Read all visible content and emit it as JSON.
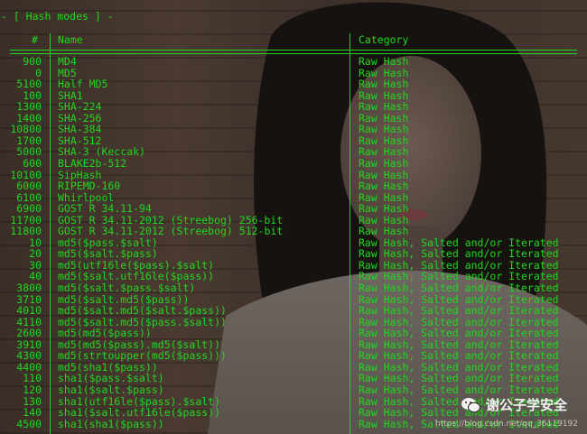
{
  "title": "- [ Hash modes ] -",
  "headers": {
    "num": "#",
    "name": "Name",
    "category": "Category"
  },
  "rows": [
    {
      "num": "900",
      "name": "MD4",
      "cat": "Raw Hash"
    },
    {
      "num": "0",
      "name": "MD5",
      "cat": "Raw Hash"
    },
    {
      "num": "5100",
      "name": "Half MD5",
      "cat": "Raw Hash"
    },
    {
      "num": "100",
      "name": "SHA1",
      "cat": "Raw Hash"
    },
    {
      "num": "1300",
      "name": "SHA-224",
      "cat": "Raw Hash"
    },
    {
      "num": "1400",
      "name": "SHA-256",
      "cat": "Raw Hash"
    },
    {
      "num": "10800",
      "name": "SHA-384",
      "cat": "Raw Hash"
    },
    {
      "num": "1700",
      "name": "SHA-512",
      "cat": "Raw Hash"
    },
    {
      "num": "5000",
      "name": "SHA-3 (Keccak)",
      "cat": "Raw Hash"
    },
    {
      "num": "600",
      "name": "BLAKE2b-512",
      "cat": "Raw Hash"
    },
    {
      "num": "10100",
      "name": "SipHash",
      "cat": "Raw Hash"
    },
    {
      "num": "6000",
      "name": "RIPEMD-160",
      "cat": "Raw Hash"
    },
    {
      "num": "6100",
      "name": "Whirlpool",
      "cat": "Raw Hash"
    },
    {
      "num": "6900",
      "name": "GOST R 34.11-94",
      "cat": "Raw Hash"
    },
    {
      "num": "11700",
      "name": "GOST R 34.11-2012 (Streebog) 256-bit",
      "cat": "Raw Hash"
    },
    {
      "num": "11800",
      "name": "GOST R 34.11-2012 (Streebog) 512-bit",
      "cat": "Raw Hash"
    },
    {
      "num": "10",
      "name": "md5($pass.$salt)",
      "cat": "Raw Hash, Salted and/or Iterated"
    },
    {
      "num": "20",
      "name": "md5($salt.$pass)",
      "cat": "Raw Hash, Salted and/or Iterated"
    },
    {
      "num": "30",
      "name": "md5(utf16le($pass).$salt)",
      "cat": "Raw Hash, Salted and/or Iterated"
    },
    {
      "num": "40",
      "name": "md5($salt.utf16le($pass))",
      "cat": "Raw Hash, Salted and/or Iterated"
    },
    {
      "num": "3800",
      "name": "md5($salt.$pass.$salt)",
      "cat": "Raw Hash, Salted and/or Iterated"
    },
    {
      "num": "3710",
      "name": "md5($salt.md5($pass))",
      "cat": "Raw Hash, Salted and/or Iterated"
    },
    {
      "num": "4010",
      "name": "md5($salt.md5($salt.$pass))",
      "cat": "Raw Hash, Salted and/or Iterated"
    },
    {
      "num": "4110",
      "name": "md5($salt.md5($pass.$salt))",
      "cat": "Raw Hash, Salted and/or Iterated"
    },
    {
      "num": "2600",
      "name": "md5(md5($pass))",
      "cat": "Raw Hash, Salted and/or Iterated"
    },
    {
      "num": "3910",
      "name": "md5(md5($pass).md5($salt))",
      "cat": "Raw Hash, Salted and/or Iterated"
    },
    {
      "num": "4300",
      "name": "md5(strtoupper(md5($pass)))",
      "cat": "Raw Hash, Salted and/or Iterated"
    },
    {
      "num": "4400",
      "name": "md5(sha1($pass))",
      "cat": "Raw Hash, Salted and/or Iterated"
    },
    {
      "num": "110",
      "name": "sha1($pass.$salt)",
      "cat": "Raw Hash, Salted and/or Iterated"
    },
    {
      "num": "120",
      "name": "sha1($salt.$pass)",
      "cat": "Raw Hash, Salted and/or Iterated"
    },
    {
      "num": "130",
      "name": "sha1(utf16le($pass).$salt)",
      "cat": "Raw Hash, Salted and/or Iterated"
    },
    {
      "num": "140",
      "name": "sha1($salt.utf16le($pass))",
      "cat": "Raw Hash, Salted and/or Iterated"
    },
    {
      "num": "4500",
      "name": "sha1(sha1($pass))",
      "cat": "Raw Hash, Salted and/or Iterated"
    }
  ],
  "watermark": {
    "icon": "wechat-icon",
    "text": "谢公子学安全",
    "url": "https://blog.csdn.net/qq_36119192"
  },
  "colors": {
    "terminal_text": "#1fd81f",
    "background": "#2a211c"
  }
}
